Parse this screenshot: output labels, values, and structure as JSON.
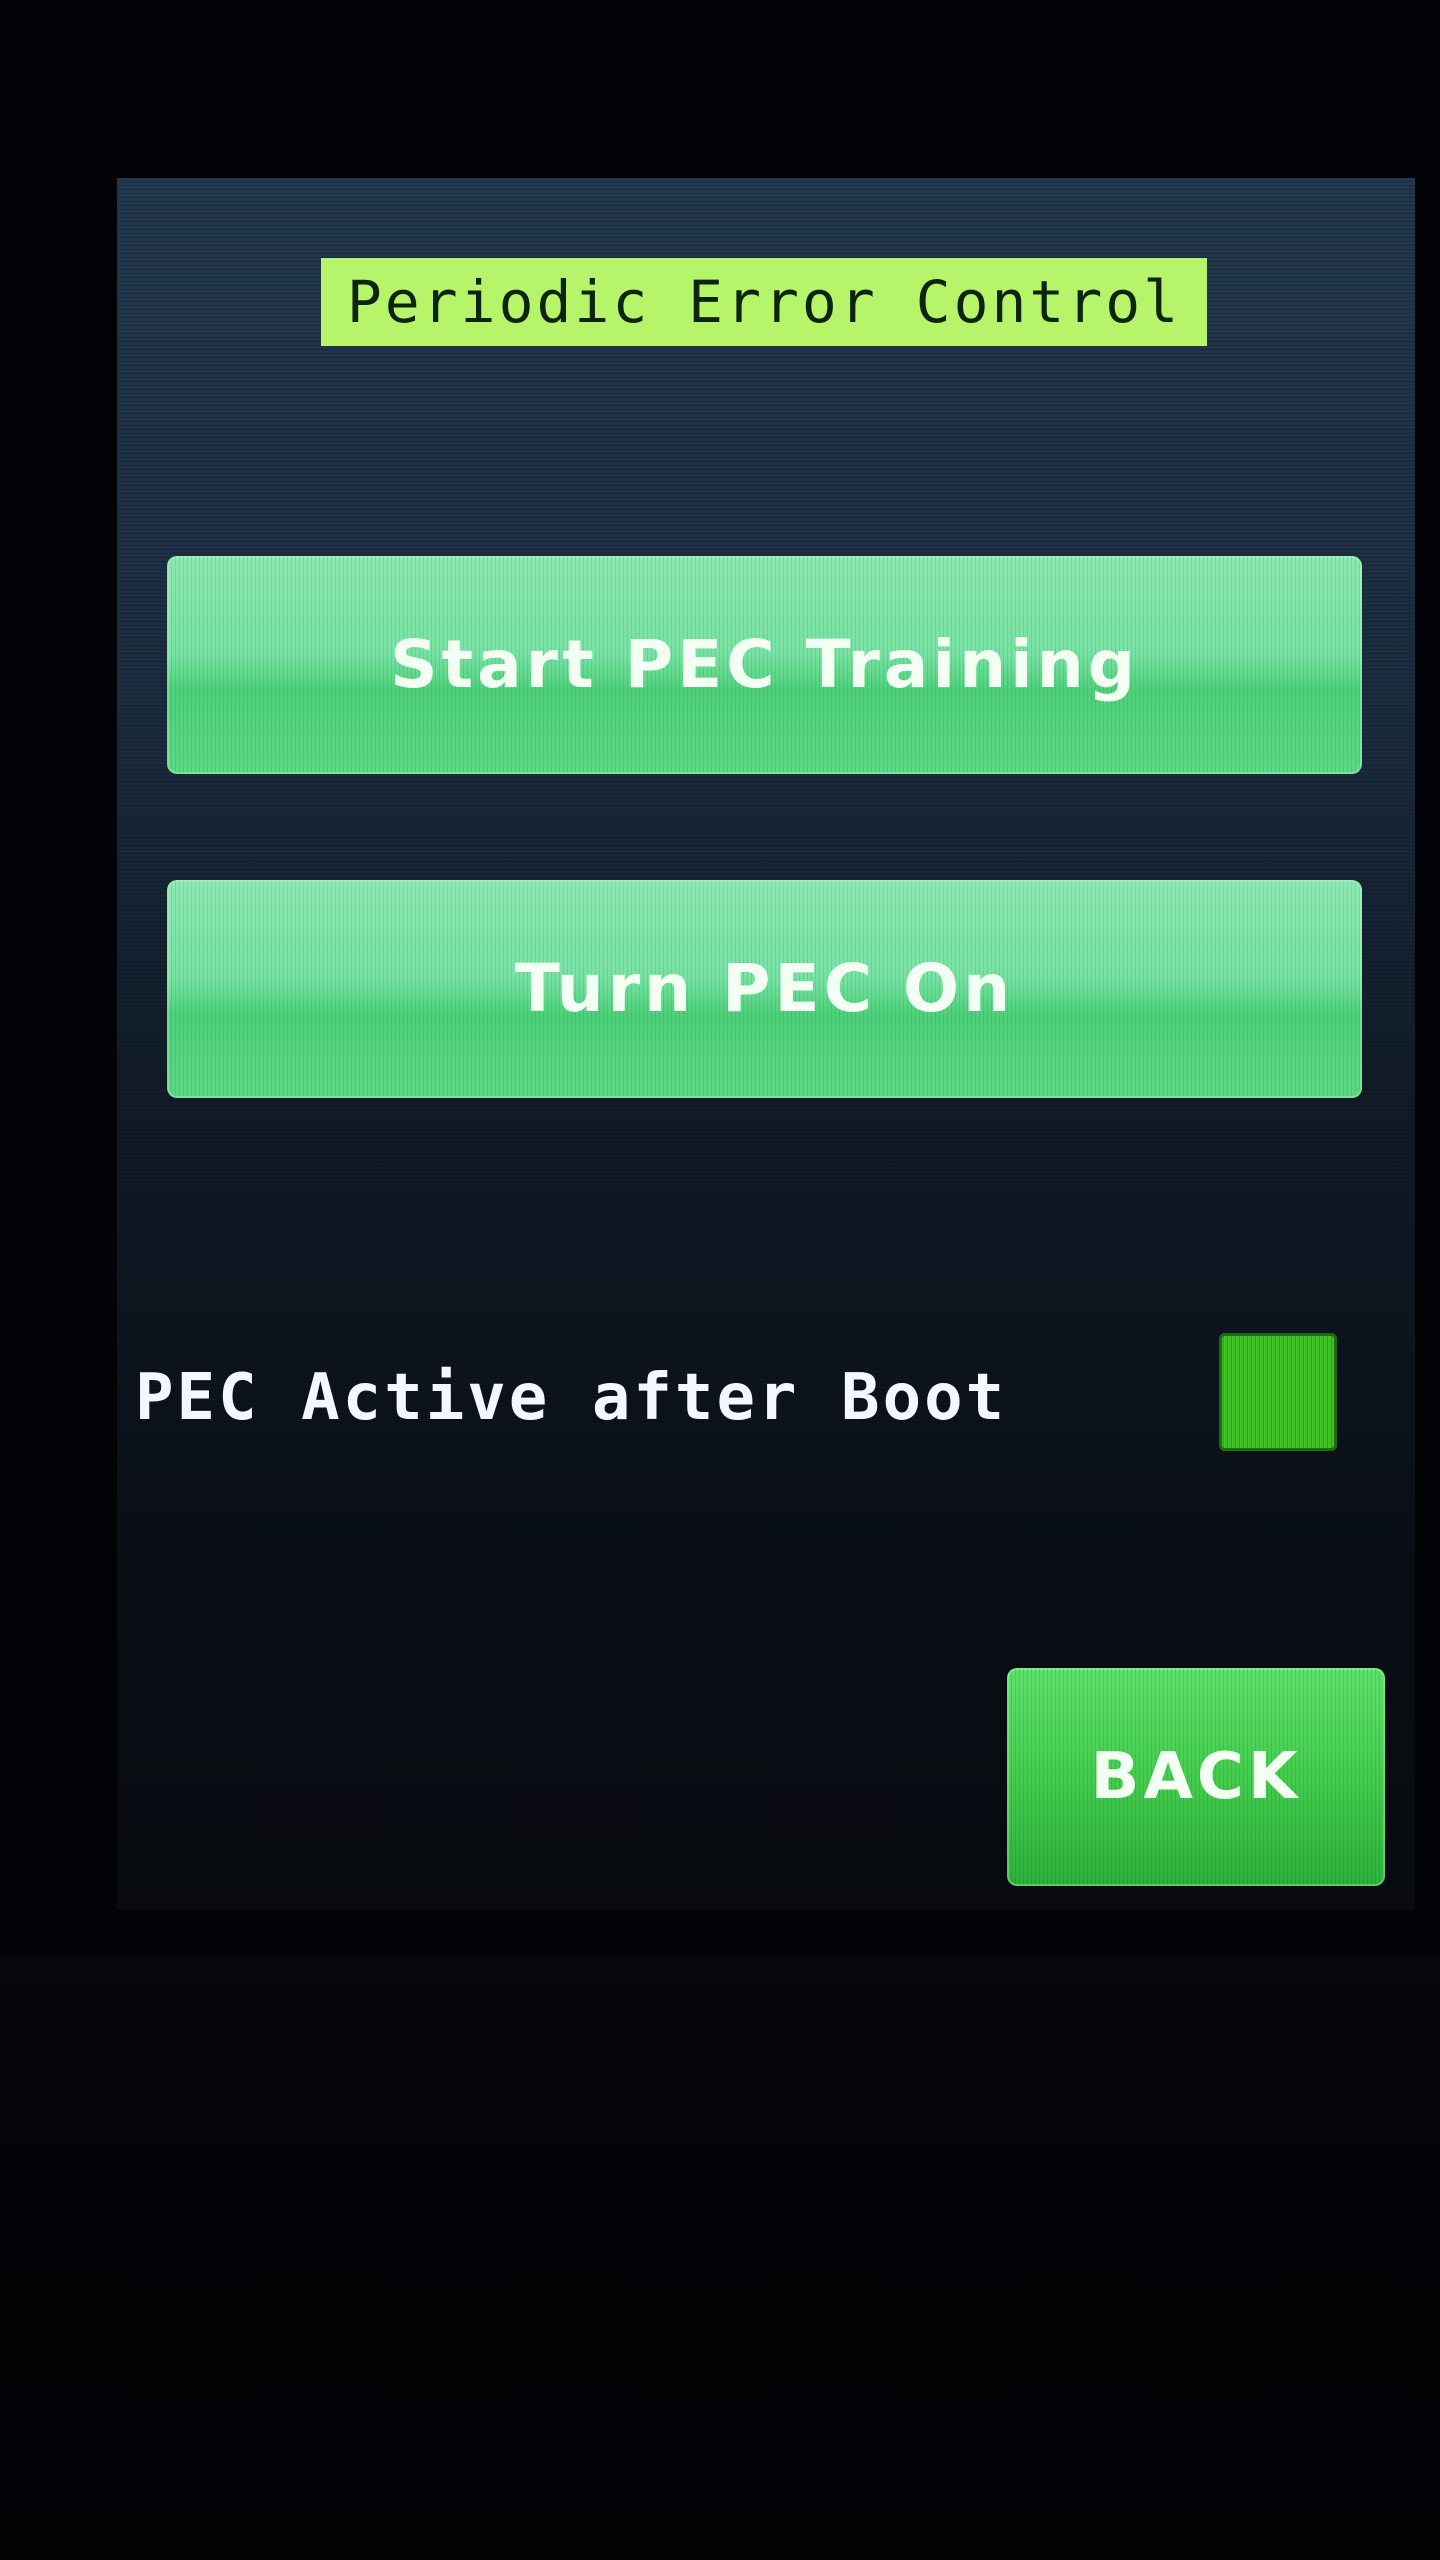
{
  "screen": {
    "title": "Periodic Error Control"
  },
  "buttons": {
    "start_training_label": "Start PEC Training",
    "turn_on_label": "Turn PEC On",
    "back_label": "BACK"
  },
  "options": {
    "pec_active_after_boot": {
      "label": "PEC Active after Boot",
      "checked": true
    }
  },
  "colors": {
    "title_bg": "#b6f46a",
    "button_green": "#78e2a4",
    "checkbox_green": "#3fc226",
    "back_green": "#45cc4f",
    "screen_bg": "#1b2c3f"
  }
}
